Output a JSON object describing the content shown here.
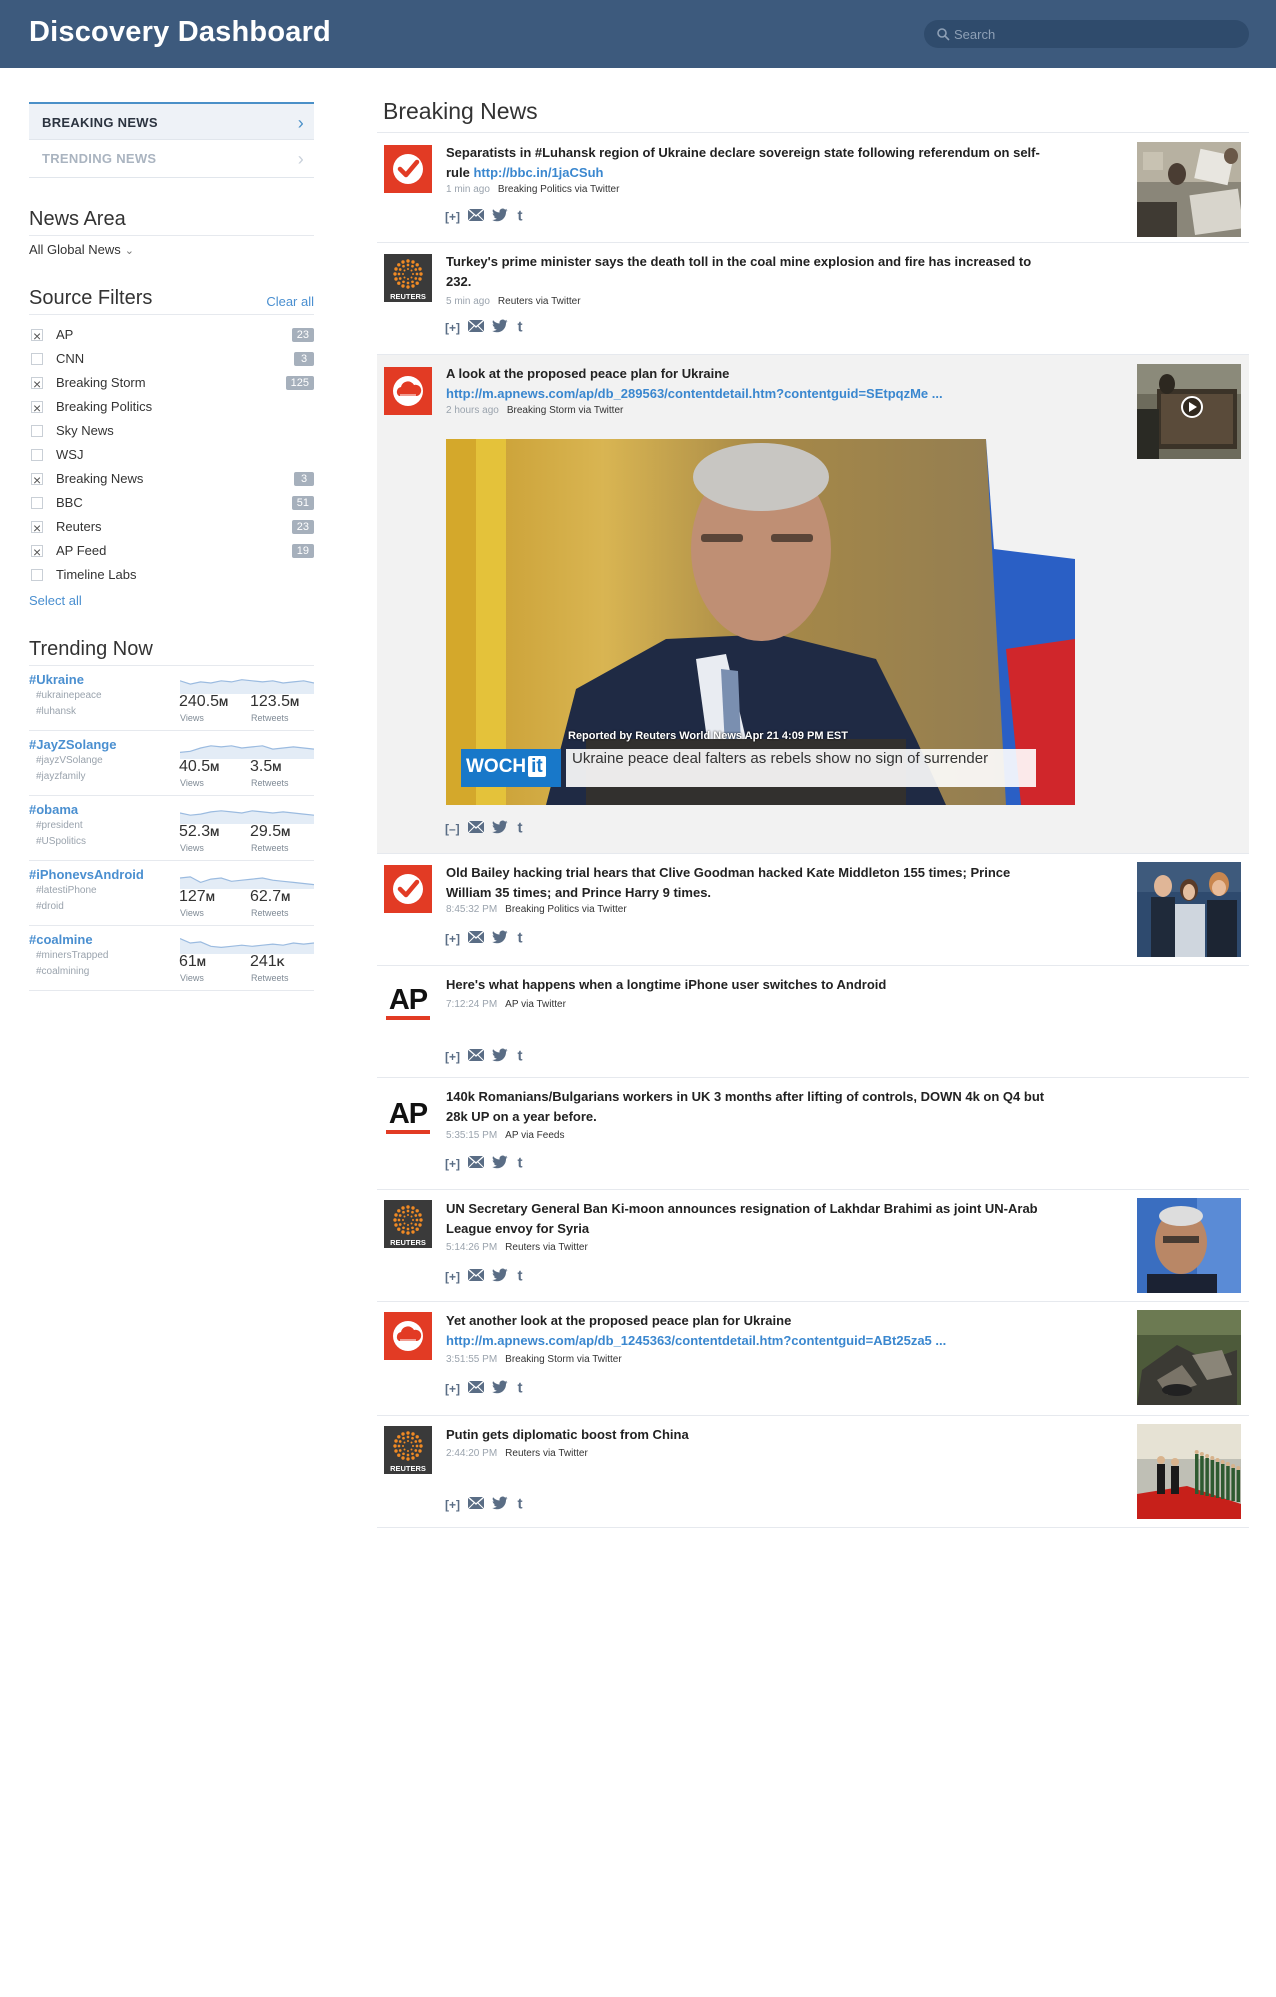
{
  "header": {
    "title": "Discovery Dashboard",
    "search_placeholder": "Search"
  },
  "sidebar": {
    "nav": [
      {
        "label": "BREAKING NEWS",
        "active": true
      },
      {
        "label": "TRENDING NEWS",
        "active": false
      }
    ],
    "news_area": {
      "title": "News Area",
      "selected": "All Global News"
    },
    "source_filters": {
      "title": "Source Filters",
      "clear_label": "Clear all",
      "select_all_label": "Select all",
      "items": [
        {
          "label": "AP",
          "checked": true,
          "count": "23"
        },
        {
          "label": "CNN",
          "checked": false,
          "count": "3"
        },
        {
          "label": "Breaking Storm",
          "checked": true,
          "count": "125"
        },
        {
          "label": "Breaking Politics",
          "checked": true,
          "count": ""
        },
        {
          "label": "Sky News",
          "checked": false,
          "count": ""
        },
        {
          "label": "WSJ",
          "checked": false,
          "count": ""
        },
        {
          "label": "Breaking News",
          "checked": true,
          "count": "3"
        },
        {
          "label": "BBC",
          "checked": false,
          "count": "51"
        },
        {
          "label": "Reuters",
          "checked": true,
          "count": "23"
        },
        {
          "label": "AP Feed",
          "checked": true,
          "count": "19"
        },
        {
          "label": "Timeline Labs",
          "checked": false,
          "count": ""
        }
      ]
    },
    "trending": {
      "title": "Trending Now",
      "views_label": "Views",
      "retweets_label": "Retweets",
      "items": [
        {
          "tag": "#Ukraine",
          "sub1": "#ukrainepeace",
          "sub2": "#luhansk",
          "views": "240.5",
          "views_unit": "M",
          "retweets": "123.5",
          "retweets_unit": "M"
        },
        {
          "tag": "#JayZSolange",
          "sub1": "#jayzVSolange",
          "sub2": "#jayzfamily",
          "views": "40.5",
          "views_unit": "M",
          "retweets": "3.5",
          "retweets_unit": "M"
        },
        {
          "tag": "#obama",
          "sub1": "#president",
          "sub2": "#USpolitics",
          "views": "52.3",
          "views_unit": "M",
          "retweets": "29.5",
          "retweets_unit": "M"
        },
        {
          "tag": "#iPhonevsAndroid",
          "sub1": "#latestiPhone",
          "sub2": "#droid",
          "views": "127",
          "views_unit": "M",
          "retweets": "62.7",
          "retweets_unit": "M"
        },
        {
          "tag": "#coalmine",
          "sub1": "#minersTrapped",
          "sub2": "#coalmining",
          "views": "61",
          "views_unit": "M",
          "retweets": "241",
          "retweets_unit": "K"
        }
      ]
    }
  },
  "main": {
    "title": "Breaking News",
    "stories": [
      {
        "source": "breaking-politics",
        "headline": "Separatists in #Luhansk region of Ukraine declare sovereign state following referendum on self-rule",
        "link": "http://bbc.in/1jaCSuh",
        "link_inline": true,
        "time": "1 min ago",
        "via": "Breaking Politics via Twitter",
        "expand": "[+]",
        "thumb": "room"
      },
      {
        "source": "reuters",
        "headline": "Turkey's prime minister says the death toll in the coal mine explosion and fire has increased to 232.",
        "link": "",
        "time": "5 min ago",
        "via": "Reuters via Twitter",
        "expand": "[+]",
        "thumb": ""
      },
      {
        "source": "breaking-storm",
        "headline": "A look at the proposed peace plan for Ukraine",
        "link": "http://m.apnews.com/ap/db_289563/contentdetail.htm?contentguid=SEtpqzMe ...",
        "link_inline": false,
        "time": "2 hours ago",
        "via": "Breaking Storm via Twitter",
        "expand": "[–]",
        "thumb": "video-thumb",
        "expanded": true,
        "video": {
          "reported": "Reported by Reuters World News Apr 21 4:09 PM EST",
          "brand": "WOCH",
          "brand_tag": "it",
          "caption": "Ukraine peace deal falters as rebels show no sign of surrender"
        }
      },
      {
        "source": "breaking-politics",
        "headline": "Old Bailey hacking trial hears that Clive Goodman hacked Kate Middleton 155 times; Prince William 35 times; and Prince Harry 9 times.",
        "link": "",
        "time": "8:45:32 PM",
        "via": "Breaking Politics via Twitter",
        "expand": "[+]",
        "thumb": "royals"
      },
      {
        "source": "ap",
        "headline": "Here's what happens when a longtime iPhone user switches to Android",
        "link": "",
        "time": "7:12:24 PM",
        "via": "AP via Twitter",
        "expand": "[+]",
        "thumb": ""
      },
      {
        "source": "ap",
        "headline": "140k Romanians/Bulgarians workers in UK 3 months after lifting of controls, DOWN 4k on Q4 but 28k UP on a year before.",
        "link": "",
        "time": "5:35:15 PM",
        "via": "AP via Feeds",
        "expand": "[+]",
        "thumb": ""
      },
      {
        "source": "reuters",
        "headline": "UN Secretary General Ban Ki-moon announces resignation of Lakhdar Brahimi as joint UN-Arab League envoy for Syria",
        "link": "",
        "time": "5:14:26 PM",
        "via": "Reuters via Twitter",
        "expand": "[+]",
        "thumb": "portrait"
      },
      {
        "source": "breaking-storm",
        "headline": "Yet another look at the proposed peace plan for Ukraine",
        "link": "http://m.apnews.com/ap/db_1245363/contentdetail.htm?contentguid=ABt25za5 ...",
        "link_inline": false,
        "time": "3:51:55 PM",
        "via": "Breaking Storm via Twitter",
        "expand": "[+]",
        "thumb": "debris"
      },
      {
        "source": "reuters",
        "headline": "Putin gets diplomatic boost from China",
        "link": "",
        "time": "2:44:20 PM",
        "via": "Reuters via Twitter",
        "expand": "[+]",
        "thumb": "ceremony"
      }
    ]
  },
  "logos": {
    "reuters_label": "REUTERS",
    "ap_label": "AP"
  },
  "colors": {
    "header": "#3d5a7d",
    "accent": "#4a8fd0",
    "brand_red": "#e23b24"
  }
}
